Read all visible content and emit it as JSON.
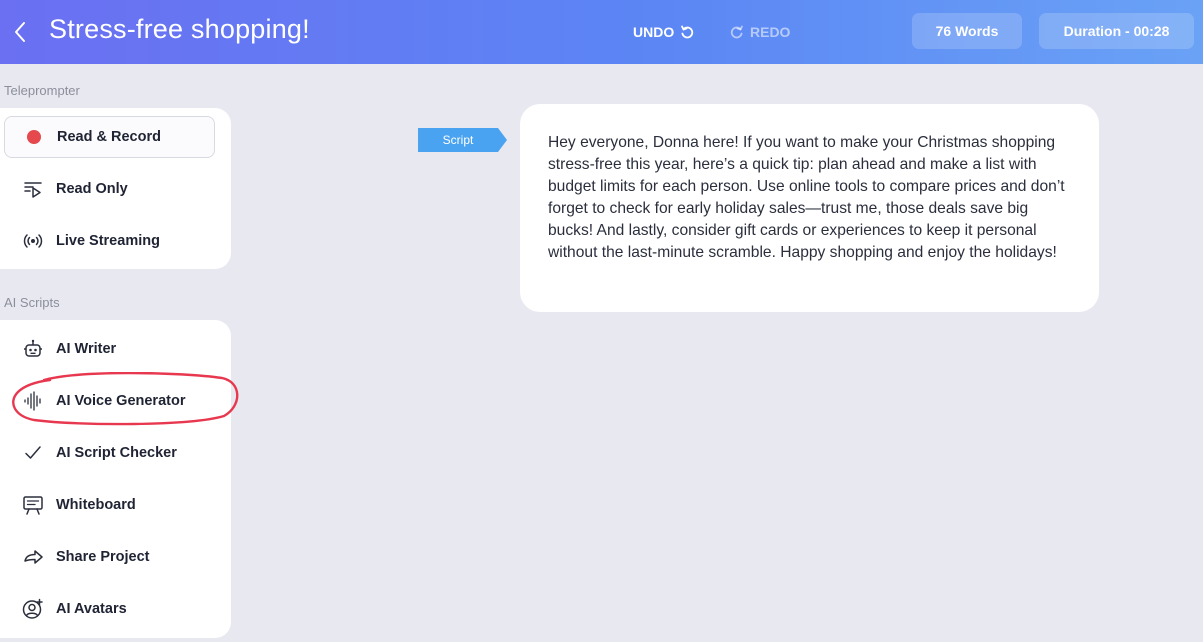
{
  "header": {
    "title": "Stress-free shopping!",
    "undo_label": "UNDO",
    "redo_label": "REDO",
    "word_count": "76 Words",
    "duration": "Duration - 00:28",
    "icons": {
      "back": "chevron-left-icon",
      "undo": "undo-icon",
      "redo": "redo-icon"
    }
  },
  "sidebar": {
    "teleprompter_label": "Teleprompter",
    "teleprompter_items": [
      {
        "label": "Read & Record",
        "icon": "record-dot-icon",
        "active": true
      },
      {
        "label": "Read Only",
        "icon": "read-only-icon",
        "active": false
      },
      {
        "label": "Live Streaming",
        "icon": "broadcast-icon",
        "active": false
      }
    ],
    "ai_scripts_label": "AI Scripts",
    "ai_items": [
      {
        "label": "AI Writer",
        "icon": "robot-icon"
      },
      {
        "label": "AI Voice Generator",
        "icon": "waveform-icon"
      },
      {
        "label": "AI Script Checker",
        "icon": "checkmark-icon"
      },
      {
        "label": "Whiteboard",
        "icon": "whiteboard-icon"
      },
      {
        "label": "Share Project",
        "icon": "share-arrow-icon"
      },
      {
        "label": "AI Avatars",
        "icon": "avatar-add-icon"
      }
    ]
  },
  "main": {
    "script_tag": "Script",
    "script_text": "Hey everyone, Donna here! If you want to make your Christmas shopping stress-free this year, here’s a quick tip: plan ahead and make a list with budget limits for each person. Use online tools to compare prices and don’t forget to check for early holiday sales—trust me, those deals save big bucks! And lastly, consider gift cards or experiences to keep it personal without the last-minute scramble. Happy shopping and enjoy the holidays!"
  },
  "colors": {
    "header_gradient_start": "#6b6ff2",
    "header_gradient_end": "#6aa2f6",
    "record_red": "#e5484d",
    "script_tag_blue": "#4aa3f0",
    "highlight_ring": "#e8384f",
    "background": "#e8e9f0"
  }
}
